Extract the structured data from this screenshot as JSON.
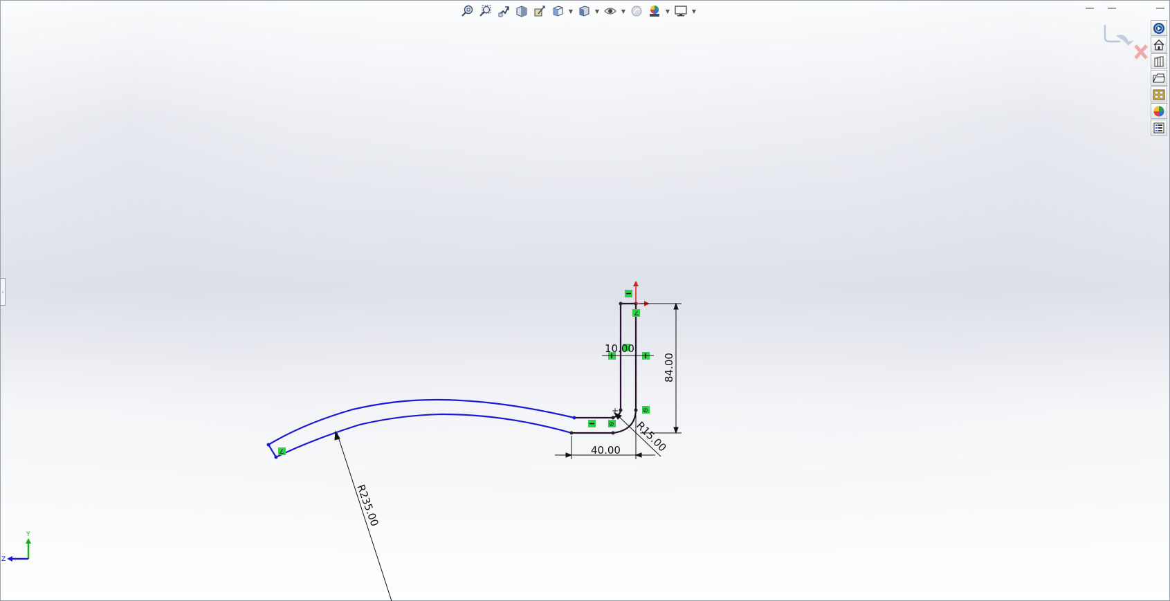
{
  "dimensions": {
    "radius_large": "R235.00",
    "radius_small": "R15.00",
    "width": "40.00",
    "height": "84.00",
    "thickness": "10.00"
  },
  "triad": {
    "y_label": "Y",
    "z_label": "Z"
  },
  "toolbar": {
    "items": [
      {
        "icon": "zoom-to-fit-icon"
      },
      {
        "icon": "zoom-to-area-icon"
      },
      {
        "icon": "previous-view-icon"
      },
      {
        "icon": "section-view-icon"
      },
      {
        "icon": "dynamic-annotation-icon"
      },
      {
        "icon": "view-orientation-icon"
      },
      {
        "icon": "display-style-icon"
      },
      {
        "icon": "hide-show-items-icon"
      },
      {
        "icon": "edit-appearance-icon"
      },
      {
        "icon": "apply-scene-icon"
      },
      {
        "icon": "view-settings-icon"
      }
    ]
  },
  "task_pane": {
    "items": [
      {
        "icon": "solidworks-resources-icon"
      },
      {
        "icon": "home-icon"
      },
      {
        "icon": "design-library-icon"
      },
      {
        "icon": "file-explorer-icon"
      },
      {
        "icon": "view-palette-icon"
      },
      {
        "icon": "appearances-icon"
      },
      {
        "icon": "custom-properties-icon"
      }
    ]
  },
  "colors": {
    "sketch_blue": "#1a1ad6",
    "sketch_black": "#2a0f2e",
    "relation_green": "#2fd04a",
    "origin_red": "#e01818"
  }
}
